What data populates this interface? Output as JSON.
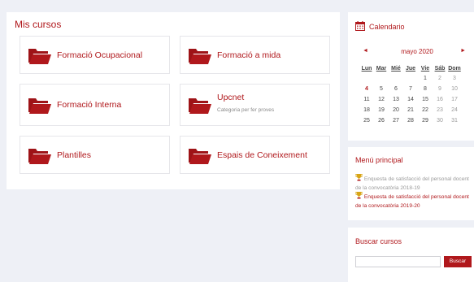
{
  "courses": {
    "title": "Mis cursos",
    "cards": [
      {
        "title": "Formació Ocupacional",
        "subtitle": ""
      },
      {
        "title": "Formació a mida",
        "subtitle": ""
      },
      {
        "title": "Formació Interna",
        "subtitle": ""
      },
      {
        "title": "Upcnet",
        "subtitle": "Categoria per fer proves"
      },
      {
        "title": "Plantilles",
        "subtitle": ""
      },
      {
        "title": "Espais de Coneixement",
        "subtitle": ""
      }
    ]
  },
  "calendar": {
    "title": "Calendario",
    "month": "mayo 2020",
    "prev": "◄",
    "next": "►",
    "weekdays": [
      "Lun",
      "Mar",
      "Mié",
      "Jue",
      "Vie",
      "Sáb",
      "Dom"
    ],
    "weeks": [
      [
        "",
        "",
        "",
        "",
        "1",
        "2",
        "3"
      ],
      [
        "4",
        "5",
        "6",
        "7",
        "8",
        "9",
        "10"
      ],
      [
        "11",
        "12",
        "13",
        "14",
        "15",
        "16",
        "17"
      ],
      [
        "18",
        "19",
        "20",
        "21",
        "22",
        "23",
        "24"
      ],
      [
        "25",
        "26",
        "27",
        "28",
        "29",
        "30",
        "31"
      ]
    ],
    "today": "4",
    "icon": "calendar-icon"
  },
  "menu": {
    "title": "Menú principal",
    "items": [
      {
        "label": "Enquesta de satisfacció del personal docent de la convocatòria 2018-19",
        "state": "dim"
      },
      {
        "label": "Enquesta de satisfacció del personal docent de la convocatòria 2019-20",
        "state": "active"
      }
    ]
  },
  "search": {
    "title": "Buscar cursos",
    "placeholder": "",
    "button": "Buscar"
  },
  "colors": {
    "accent": "#b0181c",
    "background": "#eef0f6"
  }
}
